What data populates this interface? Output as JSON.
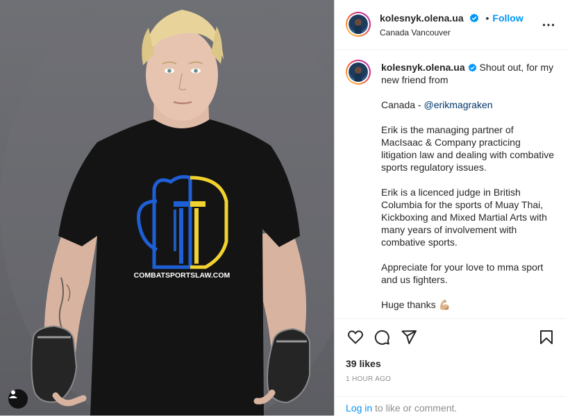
{
  "post": {
    "author": {
      "username": "kolesnyk.olena.ua",
      "verified": true,
      "location": "Canada Vancouver"
    },
    "follow_label": "Follow",
    "header_dot": "•",
    "caption": {
      "username": "kolesnyk.olena.ua",
      "line1": " Shout out, for my new friend from",
      "line2_prefix": "Canada - ",
      "mention": "@erikmagraken",
      "para2": "Erik is the managing partner of MacIsaac & Company practicing litigation law and dealing with combative sports regulatory issues.",
      "para3": "Erik is a licenced judge in British Columbia for the sports of Muay Thai, Kickboxing and Mixed Martial Arts with many years of involvement with combative sports.",
      "para4": "Appreciate for your love to mma sport and us fighters.",
      "para5": "Huge thanks",
      "emoji": "💪🏼"
    },
    "shirt_text": "COMBATSPORTSLAW.COM",
    "likes_label": "39 likes",
    "time_label": "1 HOUR AGO",
    "comment": {
      "login_label": "Log in",
      "rest_label": " to like or comment."
    },
    "icons": [
      "heart-icon",
      "comment-icon",
      "share-icon",
      "bookmark-icon",
      "more-options-icon",
      "user-tag-icon",
      "verified-badge-icon"
    ],
    "colors": {
      "accent": "#0095f6",
      "verified": "#0095f6",
      "mention": "#00376b",
      "glove_blue": "#1f5fd6",
      "glove_yellow": "#f2d22e"
    }
  }
}
